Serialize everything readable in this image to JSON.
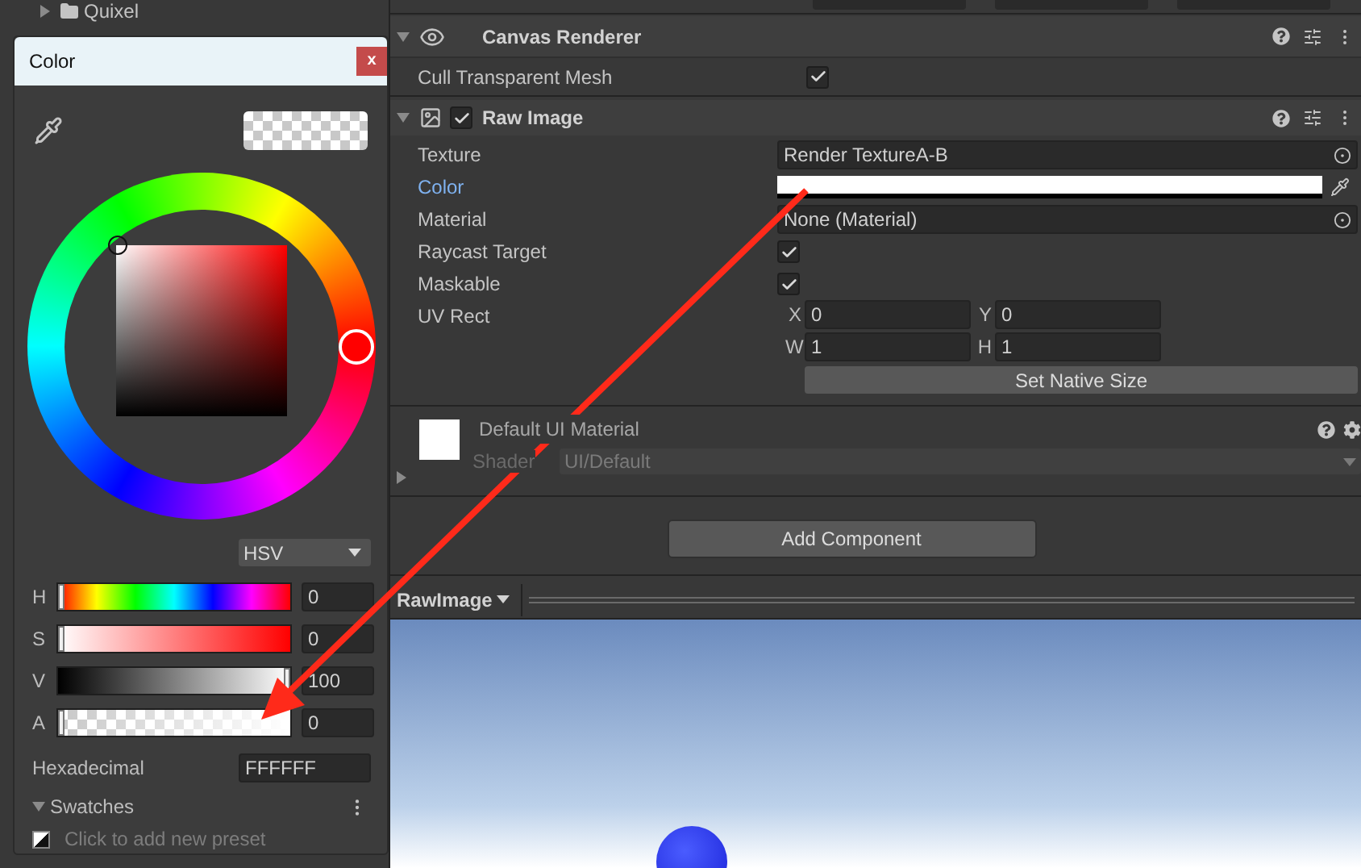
{
  "hierarchy": {
    "items": [
      {
        "label": "Quixel",
        "expanded": false
      }
    ]
  },
  "color_picker": {
    "title": "Color",
    "close": "x",
    "mode": "HSV",
    "channels": [
      {
        "label": "H",
        "kind": "hue",
        "level": 0,
        "value": "0"
      },
      {
        "label": "S",
        "kind": "saturation",
        "level": 0,
        "value": "0"
      },
      {
        "label": "V",
        "kind": "value",
        "level": 1,
        "value": "100"
      },
      {
        "label": "A",
        "kind": "alpha",
        "level": 0,
        "value": "0"
      }
    ],
    "hex_label": "Hexadecimal",
    "hex_value": "FFFFFF",
    "swatches": {
      "label": "Swatches",
      "expanded": true,
      "hint": "Click to add new preset"
    }
  },
  "inspector": {
    "canvas_renderer": {
      "title": "Canvas Renderer",
      "expanded": true,
      "properties": [
        {
          "label": "Cull Transparent Mesh",
          "kind": "checkbox",
          "checked": true,
          "selected": false
        }
      ]
    },
    "raw_image": {
      "title": "Raw Image",
      "enabled": true,
      "expanded": true,
      "properties": [
        {
          "label": "Texture",
          "kind": "object",
          "value": "Render TextureA-B",
          "selected": false
        },
        {
          "label": "Color",
          "kind": "color",
          "selected": true
        },
        {
          "label": "Material",
          "kind": "object",
          "value": "None (Material)",
          "selected": false
        },
        {
          "label": "Raycast Target",
          "kind": "checkbox",
          "checked": true,
          "selected": false
        },
        {
          "label": "Maskable",
          "kind": "checkbox",
          "checked": true,
          "selected": false
        },
        {
          "label": "UV Rect",
          "kind": "rect",
          "selected": false,
          "fields": [
            {
              "label": "X",
              "value": "0"
            },
            {
              "label": "Y",
              "value": "0"
            },
            {
              "label": "W",
              "value": "1"
            },
            {
              "label": "H",
              "value": "1"
            }
          ]
        }
      ],
      "button": "Set Native Size"
    },
    "material": {
      "name": "Default UI Material",
      "expanded": false,
      "shader_label": "Shader",
      "shader_value": "UI/Default"
    },
    "add_component": "Add Component",
    "preview": {
      "title": "RawImage"
    }
  }
}
